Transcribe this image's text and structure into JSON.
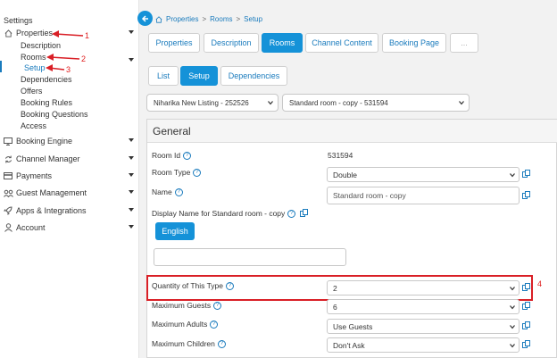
{
  "sidebar": {
    "heading": "Settings",
    "items": [
      {
        "label": "Properties",
        "icon": "home-icon"
      },
      {
        "label": "Booking Engine",
        "icon": "monitor-icon"
      },
      {
        "label": "Channel Manager",
        "icon": "sync-icon"
      },
      {
        "label": "Payments",
        "icon": "credit-card-icon"
      },
      {
        "label": "Guest Management",
        "icon": "users-icon"
      },
      {
        "label": "Apps & Integrations",
        "icon": "rocket-icon"
      },
      {
        "label": "Account",
        "icon": "user-icon"
      }
    ],
    "sub": {
      "description": "Description",
      "rooms": "Rooms",
      "setup": "Setup",
      "dependencies": "Dependencies",
      "offers": "Offers",
      "booking_rules": "Booking Rules",
      "booking_questions": "Booking Questions",
      "access": "Access"
    }
  },
  "annotations": {
    "n1": "1",
    "n2": "2",
    "n3": "3",
    "n4": "4",
    "color": "#d91f26"
  },
  "breadcrumb": {
    "home": "Properties",
    "rooms": "Rooms",
    "setup": "Setup",
    "sep": ">"
  },
  "tabs_primary": [
    "Properties",
    "Description",
    "Rooms",
    "Channel Content",
    "Booking Page",
    "..."
  ],
  "tabs_secondary": [
    "List",
    "Setup",
    "Dependencies"
  ],
  "selectors": {
    "property": "Niharika New Listing - 252526",
    "room": "Standard room - copy - 531594"
  },
  "panel": {
    "title": "General",
    "room_id_label": "Room Id",
    "room_id_value": "531594",
    "room_type_label": "Room Type",
    "room_type_value": "Double",
    "name_label": "Name",
    "name_value": "Standard room - copy",
    "display_name_label": "Display Name for Standard room - copy",
    "lang_button": "English",
    "quantity_label": "Quantity of This Type",
    "quantity_value": "2",
    "max_guests_label": "Maximum Guests",
    "max_guests_value": "6",
    "max_adults_label": "Maximum Adults",
    "max_adults_value": "Use Guests",
    "max_children_label": "Maximum Children",
    "max_children_value": "Don't Ask",
    "help": "?"
  },
  "colors": {
    "accent": "#1592d8",
    "link": "#1a7bbd",
    "annotation": "#d91f26"
  }
}
